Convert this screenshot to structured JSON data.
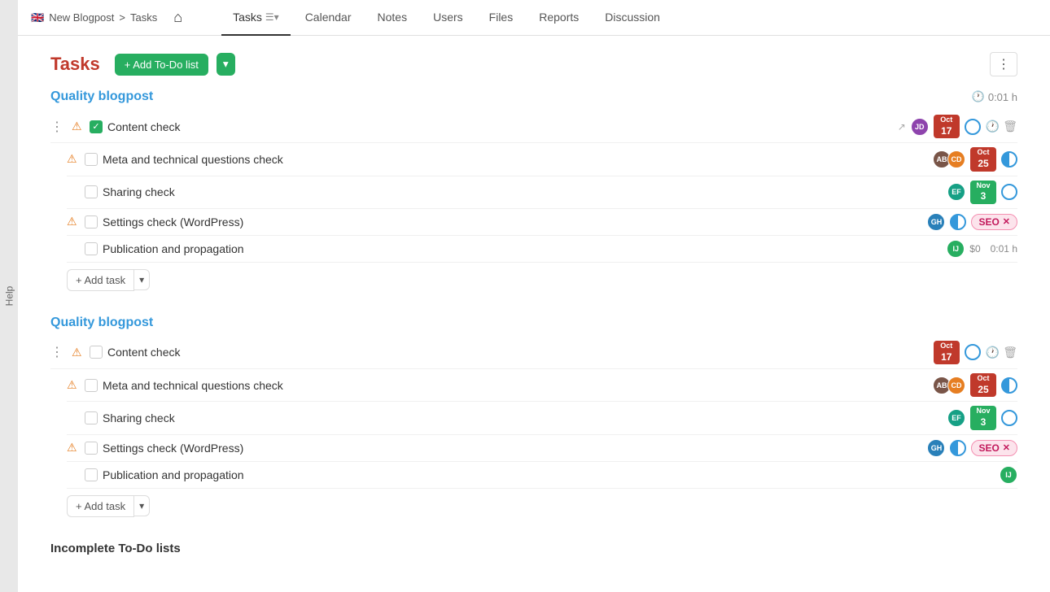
{
  "app": {
    "flag": "🇬🇧",
    "project": "New Blogpost",
    "breadcrumb_sep": ">",
    "breadcrumb_page": "Tasks"
  },
  "nav": {
    "home_icon": "⌂",
    "tabs": [
      {
        "id": "tasks",
        "label": "Tasks",
        "active": true
      },
      {
        "id": "calendar",
        "label": "Calendar",
        "active": false
      },
      {
        "id": "notes",
        "label": "Notes",
        "active": false
      },
      {
        "id": "users",
        "label": "Users",
        "active": false
      },
      {
        "id": "files",
        "label": "Files",
        "active": false
      },
      {
        "id": "reports",
        "label": "Reports",
        "active": false
      },
      {
        "id": "discussion",
        "label": "Discussion",
        "active": false
      }
    ]
  },
  "sidebar": {
    "label": "Help"
  },
  "tasks_header": {
    "title": "Tasks",
    "add_btn": "+ Add To-Do list",
    "more_icon": "⋮"
  },
  "sections": [
    {
      "id": "section1",
      "title": "Quality blogpost",
      "time": "0:01 h",
      "tasks": [
        {
          "id": "t1",
          "name": "Content check",
          "checked": true,
          "done": false,
          "warn": true,
          "indent": false,
          "avatars": [
            {
              "initials": "JD",
              "color": "purple"
            }
          ],
          "date": {
            "month": "Oct",
            "day": "17",
            "color": "red"
          },
          "status": "circle",
          "actions": [
            "play",
            "link",
            "tag"
          ],
          "seo": false,
          "price": null,
          "time": null,
          "link_icon": true
        },
        {
          "id": "t2",
          "name": "Meta and technical questions check",
          "checked": false,
          "done": false,
          "warn": true,
          "indent": true,
          "avatars": [
            {
              "initials": "AB",
              "color": "brown"
            },
            {
              "initials": "CD",
              "color": "orange"
            }
          ],
          "date": {
            "month": "Oct",
            "day": "25",
            "color": "red"
          },
          "status": "half",
          "actions": [],
          "seo": false,
          "price": null,
          "time": null
        },
        {
          "id": "t3",
          "name": "Sharing check",
          "checked": false,
          "done": false,
          "warn": false,
          "indent": true,
          "avatars": [
            {
              "initials": "EF",
              "color": "teal"
            }
          ],
          "date": {
            "month": "Nov",
            "day": "3",
            "color": "green"
          },
          "status": "circle",
          "actions": [],
          "seo": false,
          "price": null,
          "time": null
        },
        {
          "id": "t4",
          "name": "Settings check (WordPress)",
          "checked": false,
          "done": false,
          "warn": true,
          "indent": true,
          "avatars": [
            {
              "initials": "GH",
              "color": "blue"
            }
          ],
          "date": null,
          "status": "half",
          "actions": [],
          "seo": true,
          "price": null,
          "time": null
        },
        {
          "id": "t5",
          "name": "Publication and propagation",
          "checked": false,
          "done": false,
          "warn": false,
          "indent": true,
          "avatars": [
            {
              "initials": "IJ",
              "color": "green"
            }
          ],
          "date": null,
          "status": null,
          "actions": [],
          "seo": false,
          "price": "$0",
          "time": "0:01 h"
        }
      ],
      "add_task_label": "+ Add task"
    },
    {
      "id": "section2",
      "title": "Quality blogpost",
      "time": null,
      "tasks": [
        {
          "id": "t6",
          "name": "Content check",
          "checked": false,
          "done": false,
          "warn": true,
          "indent": false,
          "avatars": [],
          "date": {
            "month": "Oct",
            "day": "17",
            "color": "red"
          },
          "status": "circle",
          "actions": [],
          "seo": false,
          "price": null,
          "time": null
        },
        {
          "id": "t7",
          "name": "Meta and technical questions check",
          "checked": false,
          "done": false,
          "warn": true,
          "indent": true,
          "avatars": [
            {
              "initials": "AB",
              "color": "brown"
            },
            {
              "initials": "CD",
              "color": "orange"
            }
          ],
          "date": {
            "month": "Oct",
            "day": "25",
            "color": "red"
          },
          "status": "half",
          "actions": [],
          "seo": false,
          "price": null,
          "time": null
        },
        {
          "id": "t8",
          "name": "Sharing check",
          "checked": false,
          "done": false,
          "warn": false,
          "indent": true,
          "avatars": [
            {
              "initials": "EF",
              "color": "teal"
            }
          ],
          "date": {
            "month": "Nov",
            "day": "3",
            "color": "green"
          },
          "status": "circle",
          "actions": [],
          "seo": false,
          "price": null,
          "time": null
        },
        {
          "id": "t9",
          "name": "Settings check (WordPress)",
          "checked": false,
          "done": false,
          "warn": true,
          "indent": true,
          "avatars": [
            {
              "initials": "GH",
              "color": "blue"
            }
          ],
          "date": null,
          "status": "half",
          "actions": [],
          "seo": true,
          "price": null,
          "time": null
        },
        {
          "id": "t10",
          "name": "Publication and propagation",
          "checked": false,
          "done": false,
          "warn": false,
          "indent": true,
          "avatars": [
            {
              "initials": "IJ",
              "color": "green"
            }
          ],
          "date": null,
          "status": null,
          "actions": [],
          "seo": false,
          "price": null,
          "time": null
        }
      ],
      "add_task_label": "+ Add task"
    }
  ],
  "incomplete_heading": "Incomplete To-Do lists",
  "seo_label": "SEO",
  "clock_icon": "🕐",
  "warn_icon": "⚠",
  "play_icon": "▷",
  "link_icon": "🔗",
  "tag_icon": "🏷",
  "clock_small": "🕐",
  "trash_icon": "🗑",
  "dots_icon": "⋮"
}
